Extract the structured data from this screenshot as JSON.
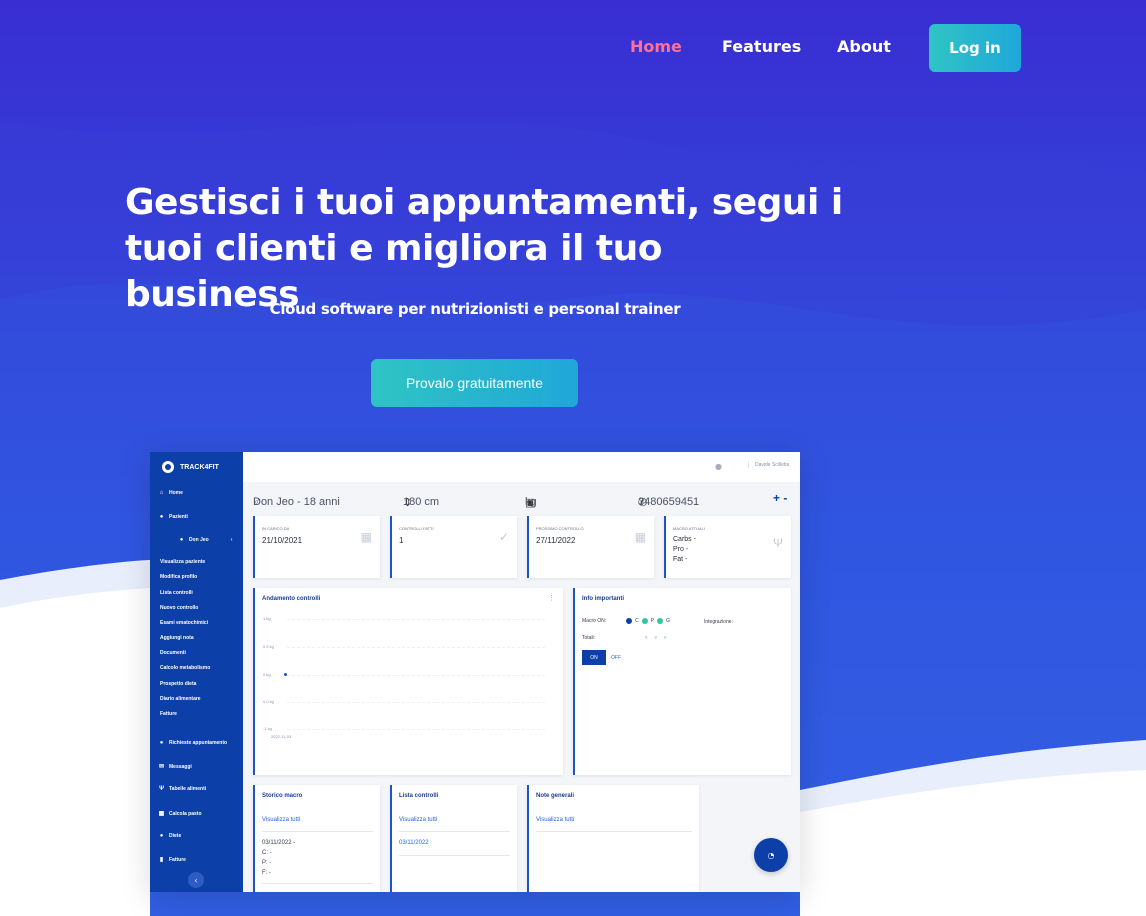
{
  "nav": {
    "links": [
      "Home",
      "Features",
      "About"
    ],
    "login_label": "Log in"
  },
  "hero": {
    "headline_line1": "Gestisci i tuoi appuntamenti, segui i",
    "headline_line2": "tuoi clienti e migliora il tuo business",
    "subheadline": "Cloud software per nutrizionisti e personal trainer",
    "cta_label": "Provalo gratuitamente"
  },
  "app": {
    "brand": "TRACK4FIT",
    "topbar_user": "Davide Scilletta",
    "sidebar": {
      "home": "Home",
      "pazienti": "Pazienti",
      "patient_name": "Don Jeo",
      "sub_items": [
        "Visualizza paziente",
        "Modifica profilo",
        "Lista controlli",
        "Nuovo controllo",
        "Esami ematochimici",
        "Aggiungi nota",
        "Documenti",
        "Calcolo metabolismo",
        "Prospetto dieta",
        "Diario alimentare",
        "Fatture"
      ],
      "richieste": "Richieste appuntamento",
      "messaggi": "Messaggi",
      "tabelle": "Tabelle alimenti",
      "calcola": "Calcola pasto",
      "diete": "Diete",
      "fatture": "Fatture"
    },
    "patient": {
      "name_age": "Don Jeo - 18 anni",
      "height": "180 cm",
      "weight": "kg",
      "phone": "3480659451",
      "action": "+ -"
    },
    "stats": [
      {
        "label": "IN CARICO DA",
        "value": "21/10/2021"
      },
      {
        "label": "CONTROLLI FATTI",
        "value": "1"
      },
      {
        "label": "PROSSIMO CONTROLLO",
        "value": "27/11/2022"
      },
      {
        "label": "MACRO ATTUALI",
        "carbs": "Carbs -",
        "pro": "Pro -",
        "fat": "Fat -"
      }
    ],
    "andamento": {
      "title": "Andamento controlli",
      "ticks": [
        "1 kg",
        "0.5 kg",
        "0 kg",
        "0.0 kg",
        "-1 kg"
      ],
      "date": "2022-11-03"
    },
    "info": {
      "title": "Info importanti",
      "macro_on": "Macro ON:",
      "c": "C",
      "p": "P",
      "g": "G",
      "integrazione": "Integrazione:",
      "totali": "Totali:",
      "on": "ON",
      "off": "OFF"
    },
    "storico": {
      "title": "Storico macro",
      "link": "Visualizza tutti",
      "date": "03/11/2022 -",
      "c": "C: -",
      "p": "P: -",
      "f": "F: -"
    },
    "lista": {
      "title": "Lista controlli",
      "link": "Visualizza tutti",
      "date": "03/11/2022"
    },
    "note": {
      "title": "Note generali",
      "link": "Visualizza tutti"
    }
  },
  "colors": {
    "accent_pink": "#ff6f9a",
    "brand_blue": "#0d3fa8",
    "teal": "#2fc4c4"
  }
}
